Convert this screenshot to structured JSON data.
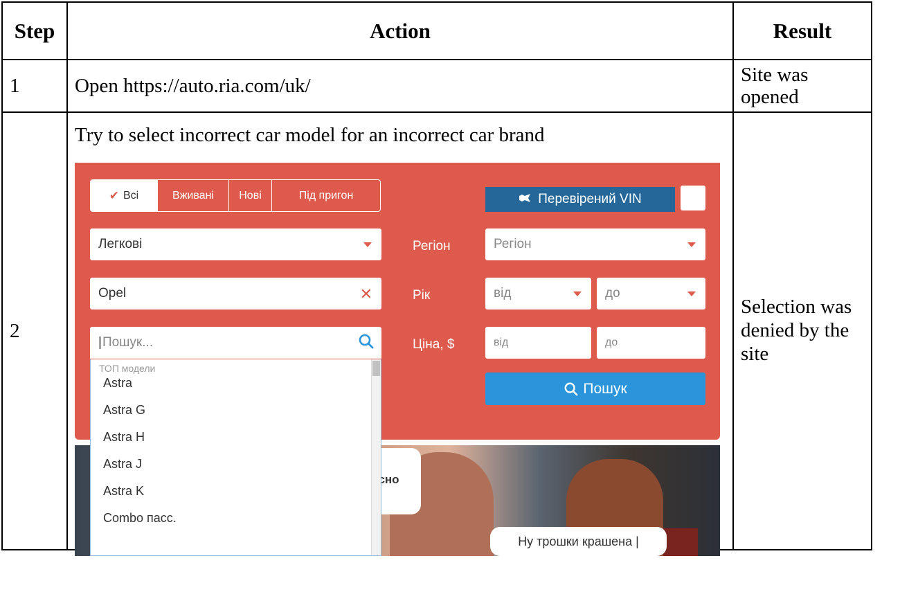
{
  "table": {
    "headers": {
      "step": "Step",
      "action": "Action",
      "result": "Result"
    },
    "rows": [
      {
        "step": "1",
        "action": "Open https://auto.ria.com/uk/",
        "result": "Site was opened"
      },
      {
        "step": "2",
        "action": "Try to select incorrect car model for an incorrect car brand",
        "result": "Selection was denied by the site"
      }
    ]
  },
  "screenshot": {
    "colors": {
      "panel": "#dd5a4c",
      "vin_badge": "#256799",
      "search_button": "#2a95da"
    },
    "condition_tabs": [
      "Всі",
      "Вживані",
      "Нові",
      "Під пригон"
    ],
    "active_tab": "Всі",
    "vin_label": "Перевірений VIN",
    "vehicle_type": "Легкові",
    "brand": "Opel",
    "model_placeholder": "Пошук...",
    "region_label": "Регіон",
    "region_placeholder": "Регіон",
    "year_label": "Рік",
    "year_from": "від",
    "year_to": "до",
    "price_label": "Ціна, $",
    "price_from": "від",
    "price_to": "до",
    "search_button": "Пошук",
    "dropdown": {
      "heading": "ТОП модели",
      "items": [
        "Astra",
        "Astra G",
        "Astra H",
        "Astra J",
        "Astra K",
        "Combo пасс."
      ]
    },
    "banner": {
      "bubble_left": "йсно",
      "bubble_right": "Ну трошки крашена |"
    },
    "icons": [
      "check-icon",
      "camera-icon",
      "chevron-down-icon",
      "clear-icon",
      "search-icon"
    ]
  }
}
